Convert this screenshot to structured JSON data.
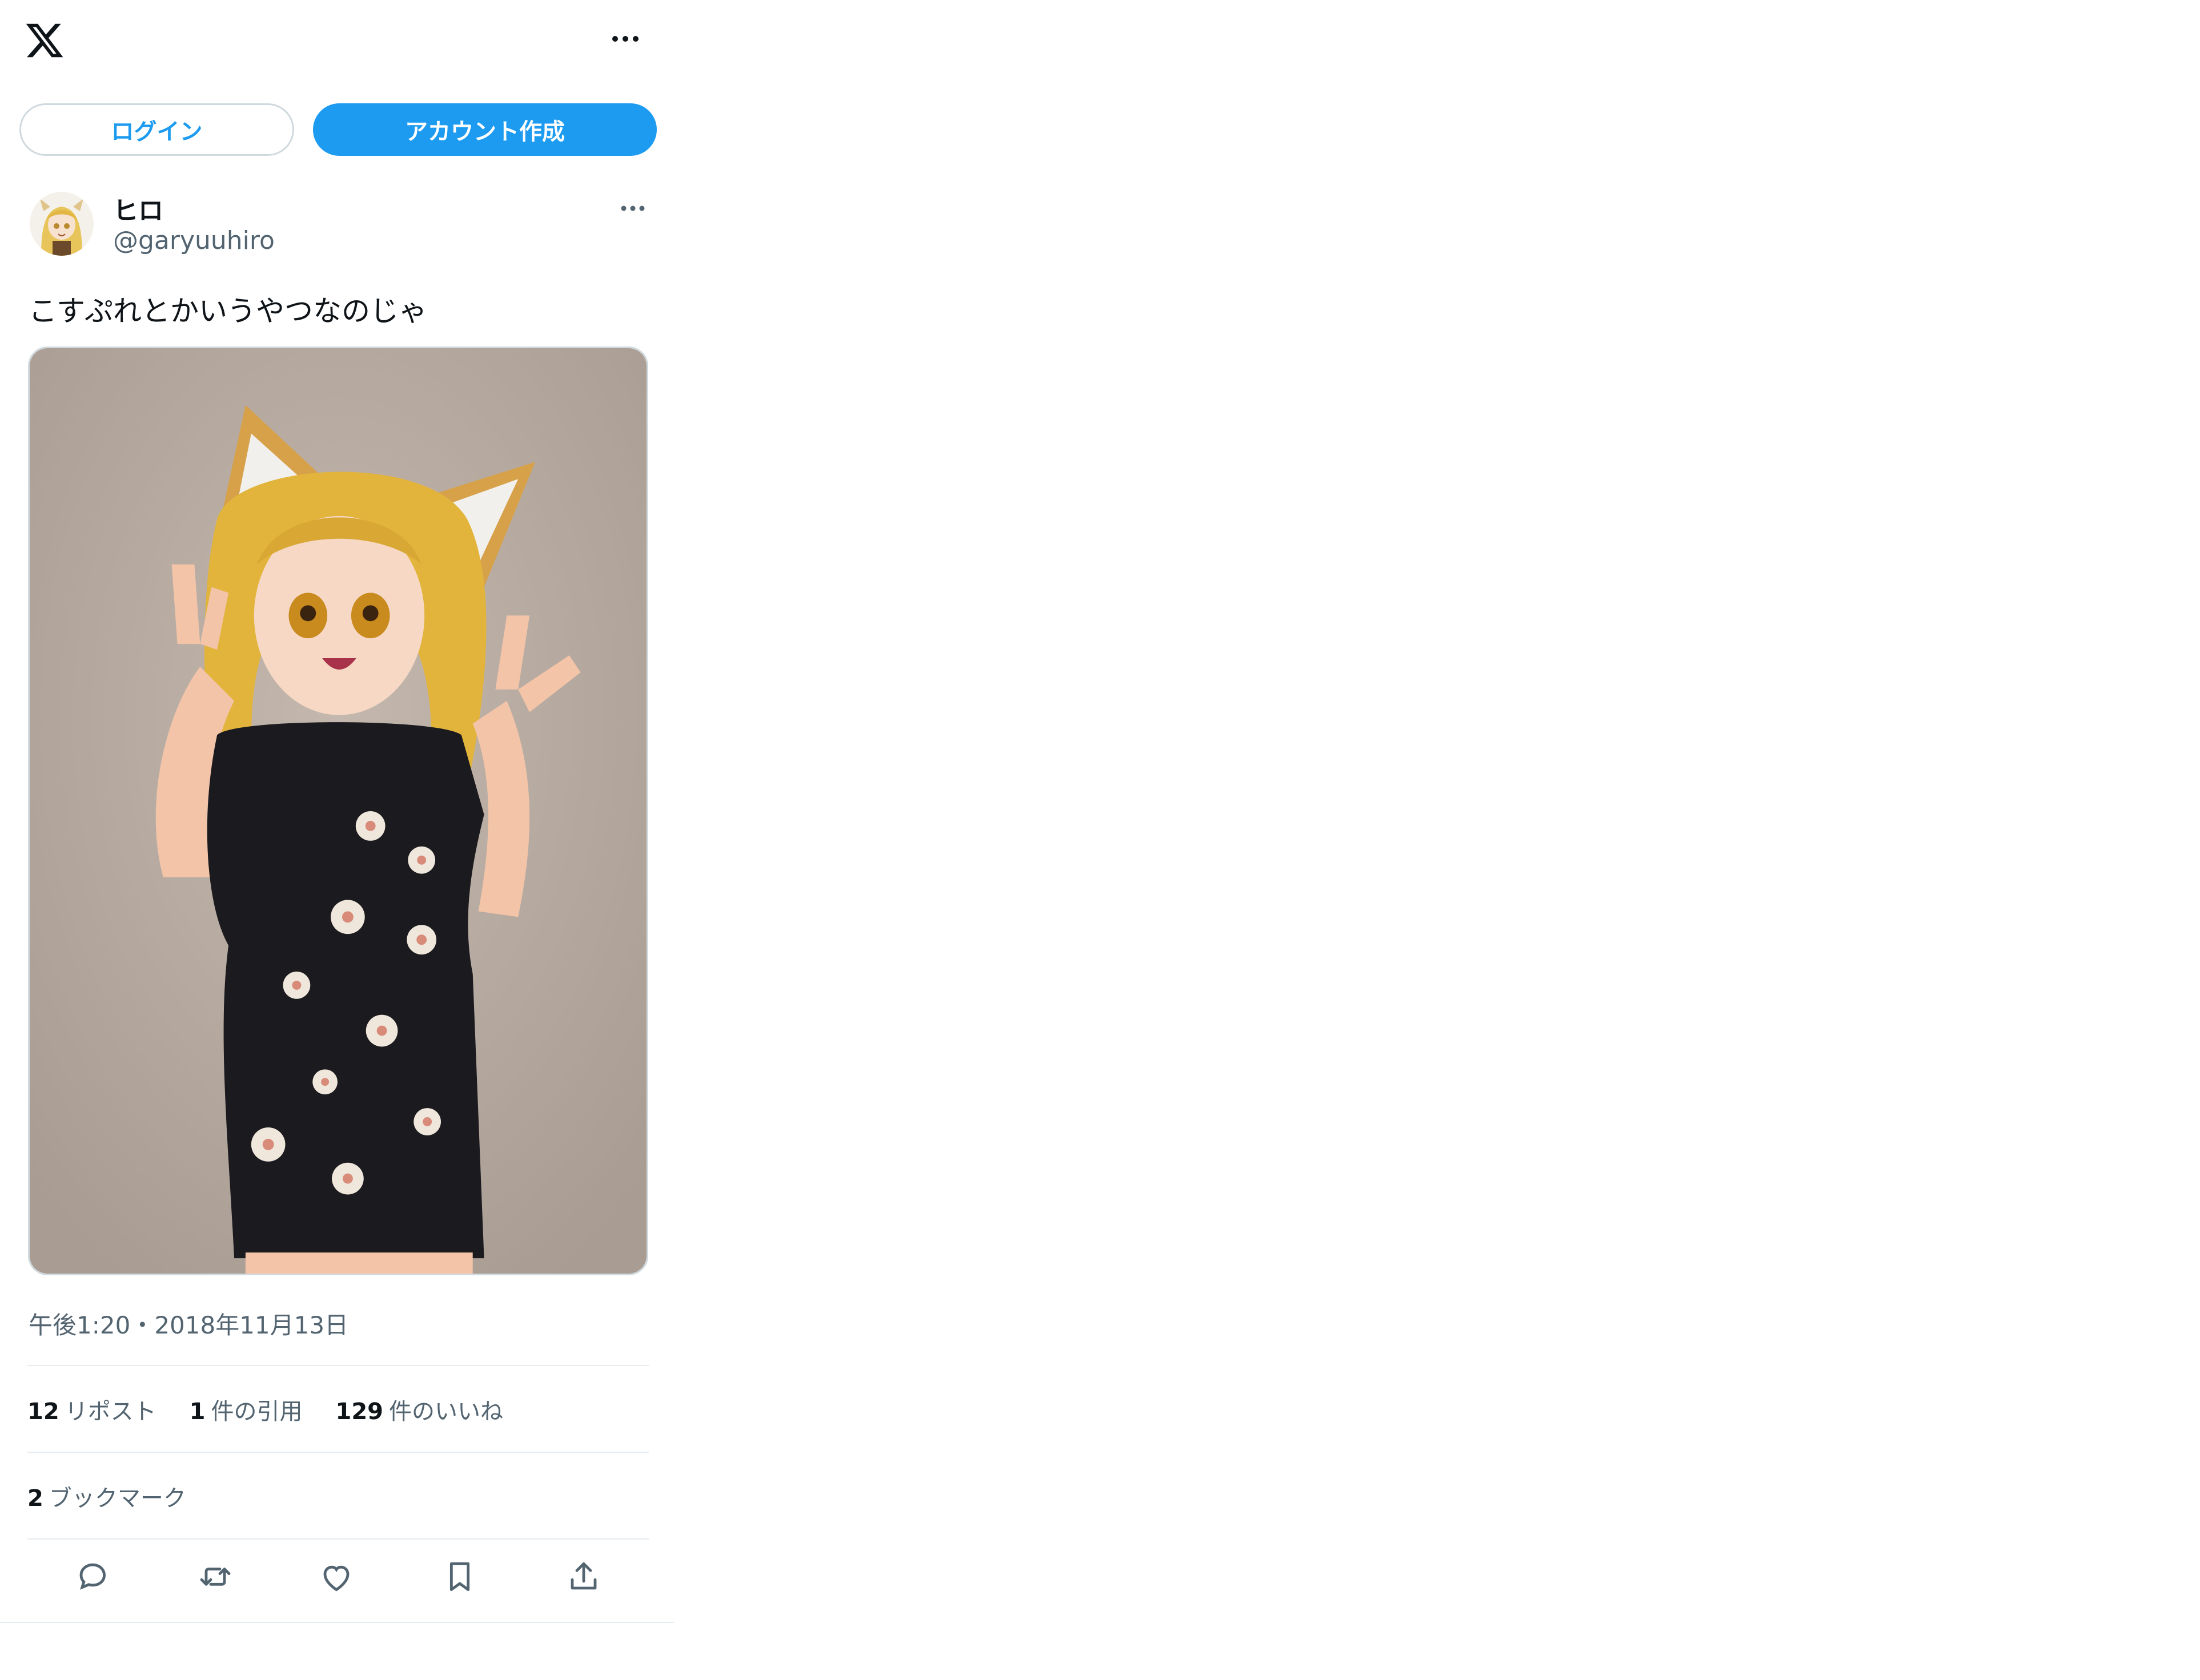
{
  "header": {
    "logo_icon": "x-logo-icon",
    "more_icon": "more-horizontal-icon"
  },
  "auth": {
    "login_label": "ログイン",
    "signup_label": "アカウント作成"
  },
  "post": {
    "author_name": "ヒロ",
    "author_handle": "@garyuuhiro",
    "text": "こすぷれとかいうやつなのじゃ",
    "timestamp": "午後1:20・2018年11月13日",
    "stats": [
      {
        "count": "12",
        "label": "リポスト"
      },
      {
        "count": "1",
        "label": "件の引用"
      },
      {
        "count": "129",
        "label": "件のいいね"
      }
    ],
    "bookmarks": {
      "count": "2",
      "label": "ブックマーク"
    }
  },
  "actions": [
    {
      "icon": "reply-icon"
    },
    {
      "icon": "repost-icon"
    },
    {
      "icon": "like-icon"
    },
    {
      "icon": "bookmark-icon"
    },
    {
      "icon": "share-icon"
    }
  ],
  "colors": {
    "accent": "#1d9bf0",
    "text": "#0f1419",
    "secondary_text": "#536471",
    "border": "#cfd9de",
    "divider": "#e6ecf0"
  }
}
